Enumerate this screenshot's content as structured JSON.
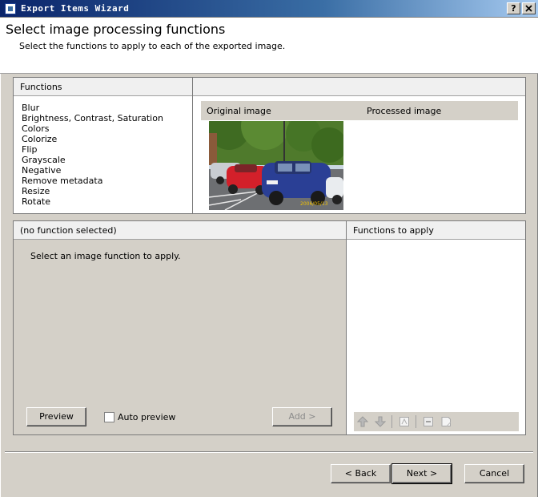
{
  "window": {
    "title": "Export Items Wizard",
    "help_label": "?",
    "close_label": "X"
  },
  "header": {
    "title": "Select image processing functions",
    "subtitle": "Select the functions to apply to each of the exported image."
  },
  "functions_panel": {
    "header": "Functions",
    "items": [
      "Blur",
      "Brightness, Contrast, Saturation",
      "Colors",
      "Colorize",
      "Flip",
      "Grayscale",
      "Negative",
      "Remove metadata",
      "Resize",
      "Rotate"
    ]
  },
  "preview_panel": {
    "original_label": "Original image",
    "processed_label": "Processed image",
    "photo_date_stamp": "2006/05/13"
  },
  "function_detail": {
    "header": "(no function selected)",
    "message": "Select an image function to apply.",
    "preview_button": "Preview",
    "auto_preview_label": "Auto preview",
    "auto_preview_checked": false,
    "add_button": "Add >"
  },
  "apply_panel": {
    "header": "Functions to apply",
    "tools": [
      "arrow-up-icon",
      "arrow-down-icon",
      "edit-icon",
      "remove-icon",
      "clear-icon"
    ]
  },
  "footer": {
    "back_button": "< Back",
    "next_button": "Next >",
    "cancel_button": "Cancel"
  }
}
